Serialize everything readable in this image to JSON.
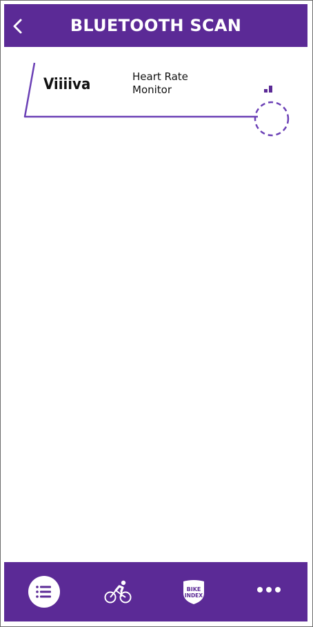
{
  "header": {
    "title": "BLUETOOTH SCAN",
    "back_icon": "chevron-left-icon"
  },
  "devices": [
    {
      "name": "Viiiiva",
      "type_line1": "Heart Rate",
      "type_line2": "Monitor",
      "signal_icon": "signal-strength-icon",
      "connect_icon": "dashed-circle-icon"
    }
  ],
  "bottom_nav": {
    "items": [
      {
        "icon": "list-icon",
        "active": true
      },
      {
        "icon": "cyclist-icon",
        "active": false
      },
      {
        "icon": "bike-index-icon",
        "label_line1": "BIKE",
        "label_line2": "INDEX",
        "active": false
      },
      {
        "icon": "more-dots-icon",
        "active": false
      }
    ]
  },
  "colors": {
    "brand_purple": "#5b2a96",
    "accent_purple": "#6a3fb5",
    "text": "#111111",
    "background": "#ffffff"
  }
}
